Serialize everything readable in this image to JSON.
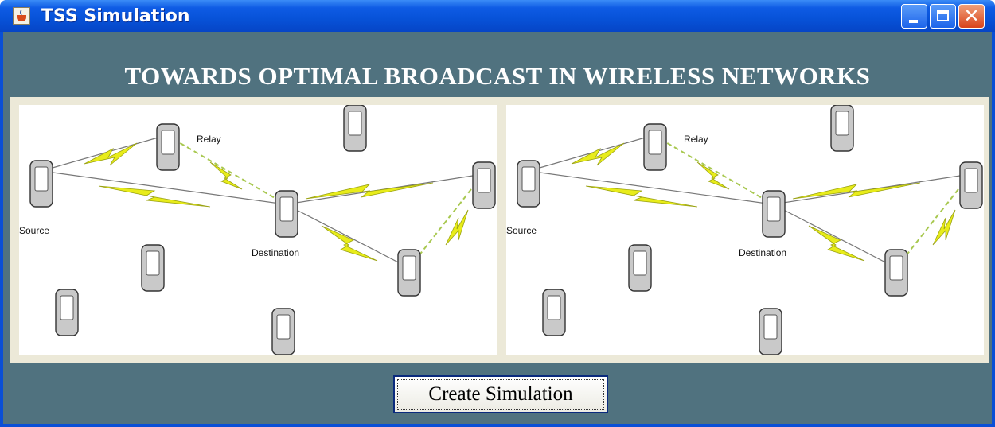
{
  "window": {
    "title": "TSS Simulation",
    "titlebar_color": "#0752d8",
    "buttons": {
      "minimize_icon": "minimize-icon",
      "maximize_icon": "maximize-icon",
      "close_icon": "close-icon"
    }
  },
  "main": {
    "heading": "TOWARDS OPTIMAL BROADCAST IN WIRELESS NETWORKS",
    "background_color": "#50727f",
    "panels": [
      {
        "labels": {
          "source": "Source",
          "relay": "Relay",
          "destination": "Destination"
        }
      },
      {
        "labels": {
          "source": "Source",
          "relay": "Relay",
          "destination": "Destination"
        }
      }
    ]
  },
  "actions": {
    "create_label": "Create Simulation"
  }
}
